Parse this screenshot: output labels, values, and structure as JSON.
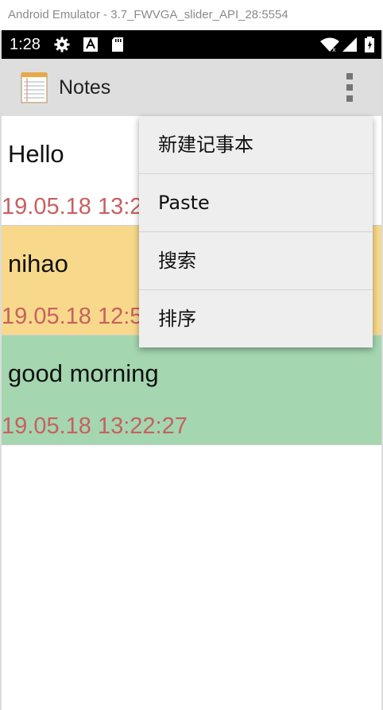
{
  "window": {
    "title": "Android Emulator - 3.7_FWVGA_slider_API_28:5554"
  },
  "status_bar": {
    "time": "1:28",
    "left_icons": [
      "gear-icon",
      "text-a-icon",
      "sd-card-icon"
    ],
    "right_icons": [
      "wifi-icon",
      "cell-signal-icon",
      "battery-icon"
    ]
  },
  "action_bar": {
    "title": "Notes",
    "app_icon": "notepad-icon",
    "overflow_icon": "more-vert-icon"
  },
  "notes": [
    {
      "title": "Hello",
      "date": "19.05.18 13:2",
      "bg": "#ffffff"
    },
    {
      "title": "nihao",
      "date": "19.05.18 12:5",
      "bg": "#f8d98b"
    },
    {
      "title": "good morning",
      "date": "19.05.18 13:22:27",
      "bg": "#a4d6b0"
    }
  ],
  "menu": {
    "items": [
      {
        "label": "新建记事本"
      },
      {
        "label": "Paste"
      },
      {
        "label": "搜索"
      },
      {
        "label": "排序"
      }
    ]
  },
  "colors": {
    "date_text": "#c86060",
    "action_bar_bg": "#dedede",
    "menu_bg": "#eeeeee",
    "status_bar_bg": "#000000"
  }
}
